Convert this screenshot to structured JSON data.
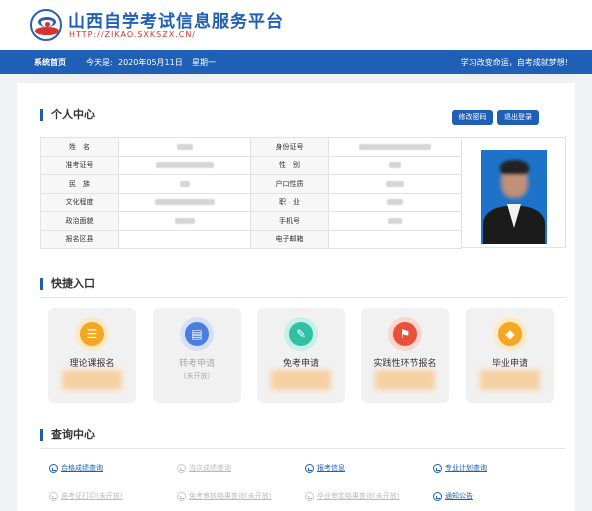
{
  "header": {
    "title": "山西自学考试信息服务平台",
    "url": "HTTP://ZIKAO.SXKSZX.CN/"
  },
  "nav": {
    "home": "系统首页",
    "date_label": "今天是:",
    "date": "2020年05月11日",
    "weekday": "星期一",
    "slogan": "学习改变命运，自考成就梦想!"
  },
  "personal": {
    "title": "个人中心",
    "edit_password": "修改密码",
    "logout": "退出登录",
    "rows": [
      {
        "l1": "姓　名",
        "l2": "身份证号"
      },
      {
        "l1": "准考证号",
        "l2": "性　别"
      },
      {
        "l1": "民　族",
        "l2": "户口性质"
      },
      {
        "l1": "文化程度",
        "l2": "职　业"
      },
      {
        "l1": "政治面貌",
        "l2": "手机号"
      },
      {
        "l1": "报名区县",
        "l2": "电子邮箱"
      }
    ]
  },
  "quick": {
    "title": "快捷入口",
    "cards": [
      {
        "label": "理论课报名",
        "sub": "",
        "icon": "book-stack-icon",
        "color": "#f5a623"
      },
      {
        "label": "转考申请",
        "sub": "(未开放)",
        "icon": "document-icon",
        "color": "#4a7de0"
      },
      {
        "label": "免考申请",
        "sub": "",
        "icon": "pencil-note-icon",
        "color": "#2fc0a6"
      },
      {
        "label": "实践性环节报名",
        "sub": "",
        "icon": "flag-icon",
        "color": "#e8503a"
      },
      {
        "label": "毕业申请",
        "sub": "",
        "icon": "graduation-cap-icon",
        "color": "#f5a623"
      }
    ]
  },
  "query": {
    "title": "查询中心",
    "links": [
      {
        "label": "合格成绩查询",
        "enabled": true
      },
      {
        "label": "当次成绩查询",
        "enabled": false
      },
      {
        "label": "报考信息",
        "enabled": true
      },
      {
        "label": "专业计划查询",
        "enabled": true
      },
      {
        "label": "准考证打印(未开放)",
        "enabled": false
      },
      {
        "label": "免考审核结果查询(未开放)",
        "enabled": false
      },
      {
        "label": "毕业审定结果查询(未开放)",
        "enabled": false
      },
      {
        "label": "通知公告",
        "enabled": true
      }
    ]
  },
  "colors": {
    "primary": "#1f5fb5",
    "accent_red": "#d8322e"
  }
}
